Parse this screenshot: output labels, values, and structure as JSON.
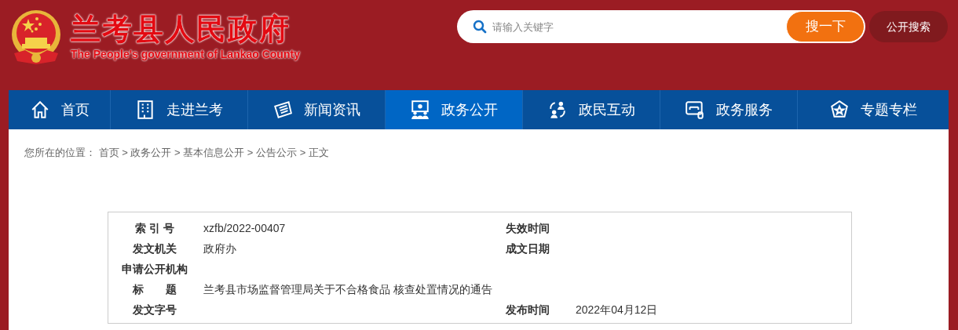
{
  "header": {
    "title": "兰考县人民政府",
    "subtitle": "The People's government of Lankao County"
  },
  "search": {
    "placeholder": "请输入关键字",
    "button": "搜一下",
    "open_search": "公开搜索"
  },
  "nav": [
    {
      "label": "首页",
      "selected": false
    },
    {
      "label": "走进兰考",
      "selected": false
    },
    {
      "label": "新闻资讯",
      "selected": false
    },
    {
      "label": "政务公开",
      "selected": true
    },
    {
      "label": "政民互动",
      "selected": false
    },
    {
      "label": "政务服务",
      "selected": false
    },
    {
      "label": "专题专栏",
      "selected": false
    }
  ],
  "breadcrumb": {
    "prefix": "您所在的位置：",
    "separator": ">",
    "items": [
      "首页",
      "政务公开",
      "基本信息公开",
      "公告公示",
      "正文"
    ]
  },
  "info_table": [
    {
      "label": "索 引 号",
      "value": "xzfb/2022-00407",
      "label_2": "失效时间"
    },
    {
      "label": "发文机关",
      "value": "政府办",
      "label_2": "成文日期"
    },
    {
      "label": "申请公开机构"
    },
    {
      "label": "标　　题",
      "value": "兰考县市场监督管理局关于不合格食品 核查处置情况的通告"
    },
    {
      "label": "发文字号",
      "label_2": "发布时间",
      "value_2": "2022年04月12日"
    }
  ]
}
